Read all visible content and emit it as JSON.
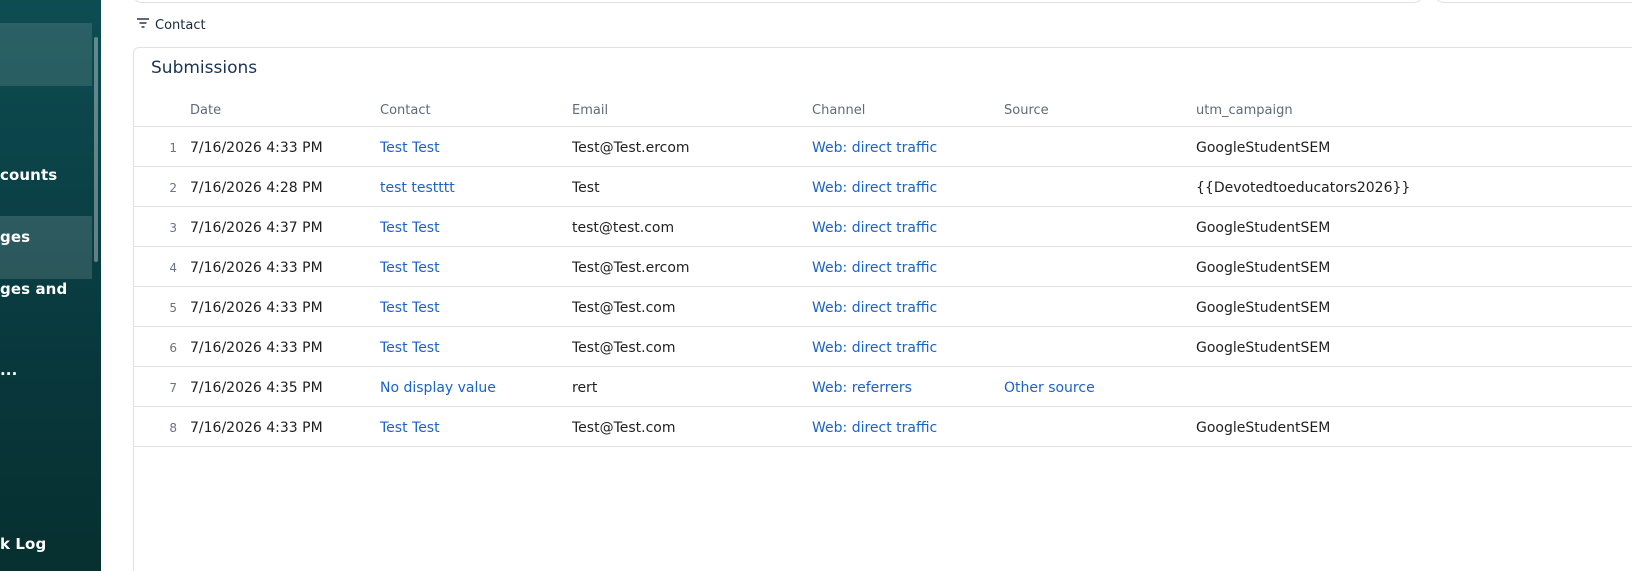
{
  "sidebar": {
    "items": [
      {
        "label": "counts"
      },
      {
        "label": "ges"
      },
      {
        "label": "ges and"
      },
      {
        "label": "..."
      },
      {
        "label": "k  Log"
      }
    ]
  },
  "filter": {
    "label": "Contact",
    "icon": "filter-icon"
  },
  "card": {
    "title": "Submissions"
  },
  "table": {
    "headers": {
      "date": "Date",
      "contact": "Contact",
      "email": "Email",
      "channel": "Channel",
      "source": "Source",
      "utm_campaign": "utm_campaign"
    },
    "rows": [
      {
        "num": "1",
        "date": "7/16/2026 4:33 PM",
        "contact": "Test Test",
        "email": "Test@Test.ercom",
        "channel": "Web: direct traffic",
        "source": "",
        "utm_campaign": "GoogleStudentSEM"
      },
      {
        "num": "2",
        "date": "7/16/2026 4:28 PM",
        "contact": "test testttt",
        "email": "Test",
        "channel": "Web: direct traffic",
        "source": "",
        "utm_campaign": "{{Devotedtoeducators2026}}"
      },
      {
        "num": "3",
        "date": "7/16/2026 4:37 PM",
        "contact": "Test Test",
        "email": "test@test.com",
        "channel": "Web: direct traffic",
        "source": "",
        "utm_campaign": "GoogleStudentSEM"
      },
      {
        "num": "4",
        "date": "7/16/2026 4:33 PM",
        "contact": "Test Test",
        "email": "Test@Test.ercom",
        "channel": "Web: direct traffic",
        "source": "",
        "utm_campaign": "GoogleStudentSEM"
      },
      {
        "num": "5",
        "date": "7/16/2026 4:33 PM",
        "contact": "Test Test",
        "email": "Test@Test.com",
        "channel": "Web: direct traffic",
        "source": "",
        "utm_campaign": "GoogleStudentSEM"
      },
      {
        "num": "6",
        "date": "7/16/2026 4:33 PM",
        "contact": "Test Test",
        "email": "Test@Test.com",
        "channel": "Web: direct traffic",
        "source": "",
        "utm_campaign": "GoogleStudentSEM"
      },
      {
        "num": "7",
        "date": "7/16/2026 4:35 PM",
        "contact": "No display value",
        "email": "rert",
        "channel": "Web: referrers",
        "source": "Other source",
        "utm_campaign": ""
      },
      {
        "num": "8",
        "date": "7/16/2026 4:33 PM",
        "contact": "Test Test",
        "email": "Test@Test.com",
        "channel": "Web: direct traffic",
        "source": "",
        "utm_campaign": "GoogleStudentSEM"
      }
    ]
  },
  "colors": {
    "sidebar_bg": "#0a3f45",
    "link": "#1a63c7",
    "title": "#1b3352",
    "border": "#dfe3e8"
  }
}
